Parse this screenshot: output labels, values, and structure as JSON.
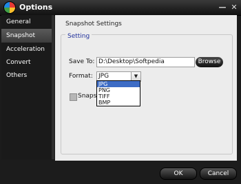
{
  "window": {
    "title": "Options",
    "minimize_glyph": "—",
    "close_glyph": "✕"
  },
  "sidebar": {
    "items": [
      {
        "label": "General"
      },
      {
        "label": "Snapshot"
      },
      {
        "label": "Acceleration"
      },
      {
        "label": "Convert"
      },
      {
        "label": "Others"
      }
    ],
    "selected": "Snapshot"
  },
  "panel": {
    "title": "Snapshot Settings",
    "group_title": "Setting",
    "save_to_label": "Save To:",
    "save_to_value": "D:\\Desktop\\Softpedia",
    "browse_label": "Browse",
    "format_label": "Format:",
    "format_value": "JPG",
    "format_options": [
      "JPG",
      "PNG",
      "TIFF",
      "BMP"
    ],
    "checkbox_label_visible": "Snaps"
  },
  "footer": {
    "ok_label": "OK",
    "cancel_label": "Cancel"
  },
  "icons": {
    "app_icon": "app-logo-icon",
    "dropdown_arrow": "▼"
  },
  "colors": {
    "group_title": "#1f2f9a",
    "selected_option": "#3d6cc5",
    "sidebar_bg": "#1a1a1a",
    "panel_bg": "#ececec"
  }
}
